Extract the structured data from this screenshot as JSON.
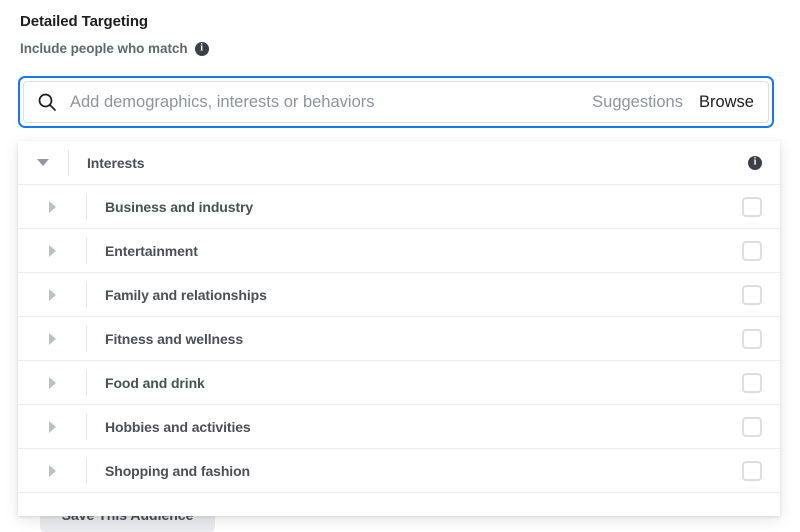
{
  "header": {
    "title": "Detailed Targeting",
    "subtitle": "Include people who match",
    "subtitle_info_icon": "info-icon",
    "info_glyph": "i"
  },
  "search": {
    "icon": "search-icon",
    "placeholder": "Add demographics, interests or behaviors",
    "value": "",
    "suggestions_label": "Suggestions",
    "browse_label": "Browse"
  },
  "dropdown": {
    "group_header": {
      "label": "Interests",
      "expanded": true,
      "arrow_icon": "chevron-down-icon",
      "info_icon": "info-icon",
      "info_glyph": "i"
    },
    "items": [
      {
        "label": "Business and industry",
        "expanded": false,
        "checked": false
      },
      {
        "label": "Entertainment",
        "expanded": false,
        "checked": false
      },
      {
        "label": "Family and relationships",
        "expanded": false,
        "checked": false
      },
      {
        "label": "Fitness and wellness",
        "expanded": false,
        "checked": false
      },
      {
        "label": "Food and drink",
        "expanded": false,
        "checked": false
      },
      {
        "label": "Hobbies and activities",
        "expanded": false,
        "checked": false
      },
      {
        "label": "Shopping and fashion",
        "expanded": false,
        "checked": false
      }
    ]
  },
  "background": {
    "save_audience_label": "Save This Audience"
  },
  "colors": {
    "focus_border": "#1877f2",
    "text_primary": "#1c1e21",
    "text_secondary": "#606770",
    "placeholder": "#8d949e",
    "row_label": "#4b4f56",
    "divider": "#ebedf0",
    "checkbox_border": "#dcdee3",
    "info_badge": "#3b4048",
    "button_bg": "#e9ebee"
  }
}
